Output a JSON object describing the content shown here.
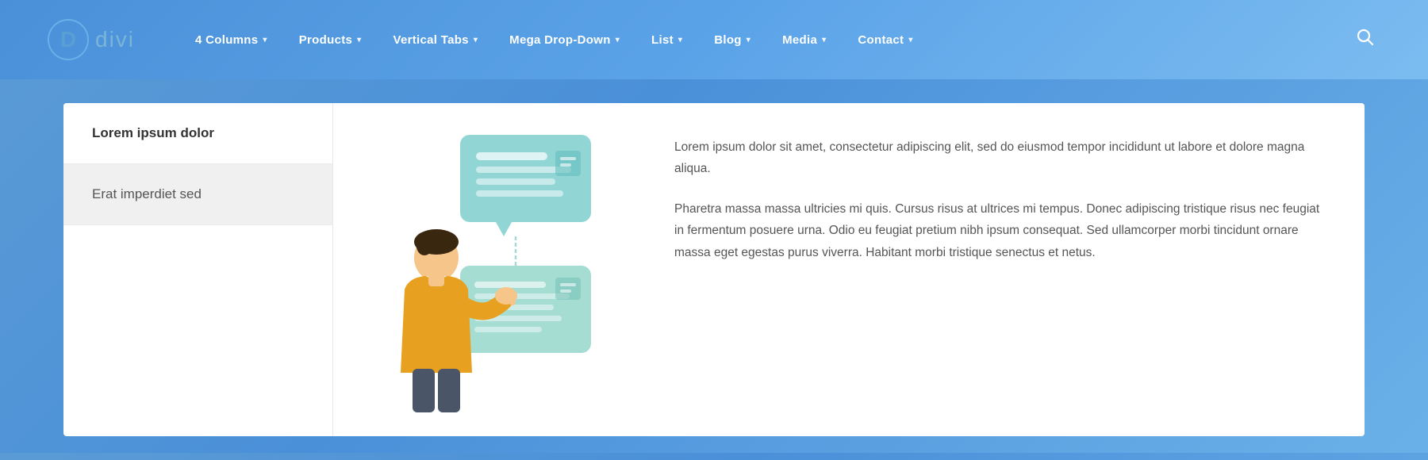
{
  "logo": {
    "letter": "D",
    "name": "divi"
  },
  "nav": {
    "items": [
      {
        "label": "4 Columns",
        "has_dropdown": true
      },
      {
        "label": "Products",
        "has_dropdown": true
      },
      {
        "label": "Vertical Tabs",
        "has_dropdown": true
      },
      {
        "label": "Mega Drop-Down",
        "has_dropdown": true
      },
      {
        "label": "List",
        "has_dropdown": true
      },
      {
        "label": "Blog",
        "has_dropdown": true
      },
      {
        "label": "Media",
        "has_dropdown": true
      },
      {
        "label": "Contact",
        "has_dropdown": true
      }
    ]
  },
  "left_panel": {
    "item1": "Lorem ipsum dolor",
    "item2": "Erat imperdiet sed"
  },
  "right_text": {
    "paragraph1": "Lorem ipsum dolor sit amet, consectetur adipiscing elit, sed do eiusmod tempor incididunt ut labore et dolore magna aliqua.",
    "paragraph2": "Pharetra massa massa ultricies mi quis. Cursus risus at ultrices mi tempus. Donec adipiscing tristique risus nec feugiat in fermentum posuere urna. Odio eu feugiat pretium nibh ipsum consequat. Sed ullamcorper morbi tincidunt ornare massa eget egestas purus viverra. Habitant morbi tristique senectus et netus."
  },
  "colors": {
    "header_bg_start": "#4a90d9",
    "header_bg_end": "#7bbcf0",
    "accent": "#5b9bd5",
    "teal": "#6abfbf",
    "body_bg": "#5a9fd4"
  }
}
